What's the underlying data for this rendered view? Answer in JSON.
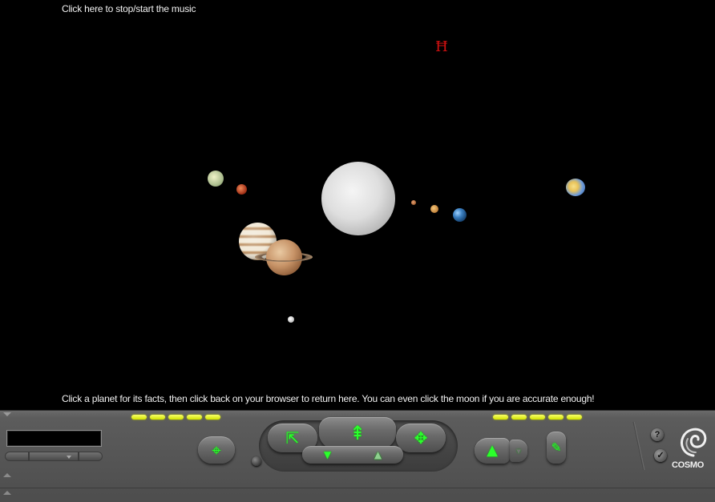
{
  "scene": {
    "music_link": "Click here to stop/start the music",
    "instructions": "Click a planet for its facts, then click back on your browser to return here. You can even click the moon if you are accurate enough!",
    "bodies": [
      "sun",
      "mercury",
      "venus",
      "earth",
      "mars",
      "jupiter",
      "saturn",
      "uranus",
      "neptune",
      "moon"
    ]
  },
  "toolbar": {
    "brand": "COSMO",
    "viewpoint_value": "",
    "help_label": "?",
    "check_label": "✓",
    "status_light_color": "#e6f200",
    "icon_color": "#2bff2b",
    "icons": {
      "target": "crosshair-icon",
      "go": "go-icon",
      "zoom": "zoom-icon",
      "pan": "pan-icon",
      "tilt_down": "tilt-down-icon",
      "tilt_up": "tilt-up-icon",
      "climb": "climb-icon",
      "straighten": "straighten-icon"
    }
  }
}
